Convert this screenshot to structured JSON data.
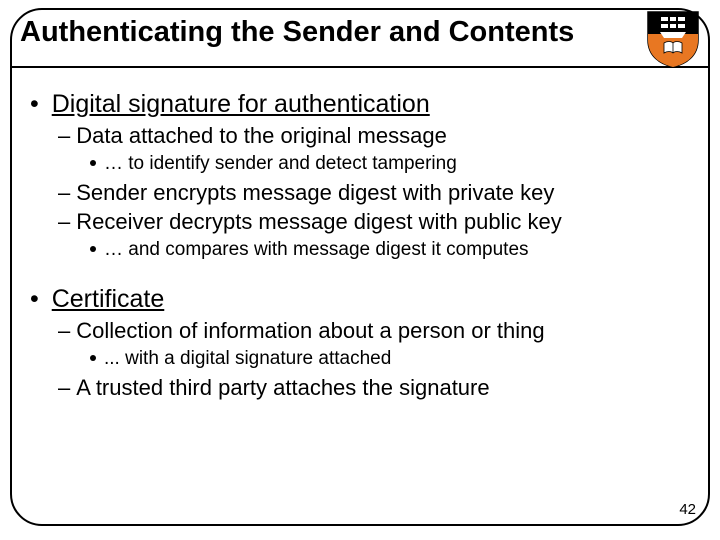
{
  "title": "Authenticating the Sender and Contents",
  "page_number": "42",
  "shield": {
    "name": "princeton-shield-icon",
    "colors": {
      "orange": "#e77500",
      "black": "#000000",
      "white": "#ffffff"
    }
  },
  "bullets": [
    {
      "text": "Digital signature for authentication",
      "sub": [
        {
          "text": "Data attached to the original message",
          "sub": [
            {
              "text": "… to identify sender and detect tampering"
            }
          ]
        },
        {
          "text": "Sender encrypts message digest with private key"
        },
        {
          "text": "Receiver decrypts message digest with public key",
          "sub": [
            {
              "text": "… and compares with message digest it computes"
            }
          ]
        }
      ]
    },
    {
      "text": "Certificate",
      "sub": [
        {
          "text": "Collection of information about a person or thing",
          "sub": [
            {
              "text": "... with a digital signature attached"
            }
          ]
        },
        {
          "text": "A trusted third party attaches the signature"
        }
      ]
    }
  ]
}
